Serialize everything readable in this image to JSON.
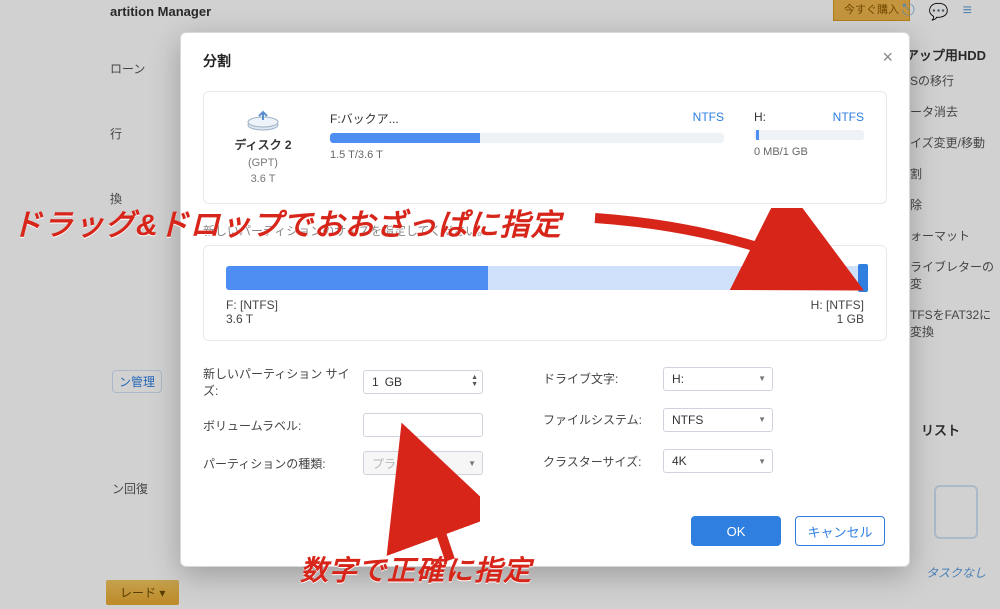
{
  "header": {
    "title_fragment": "artition Manager",
    "buy_button": "今すぐ購入"
  },
  "bg_left": [
    "ローン",
    "行",
    "換",
    "ン管理",
    "ン回復"
  ],
  "bg_upgrade": "レード ▾",
  "bg_right_title": "アップ用HDD",
  "bg_right_items": [
    "Sの移行",
    "ータ消去",
    "イズ変更/移動",
    "割",
    "除",
    "ォーマット",
    "ライブレターの変",
    "TFSをFAT32に変換"
  ],
  "bg_right_listlabel": "リスト",
  "bg_tasknone": "タスクなし",
  "modal": {
    "title": "分割",
    "disk": {
      "name": "ディスク 2",
      "style": "(GPT)",
      "size": "3.6 T"
    },
    "barA": {
      "label": "F:バックア...",
      "fs": "NTFS",
      "usage": "1.5 T/3.6 T"
    },
    "barB": {
      "label": "H:",
      "fs": "NTFS",
      "usage": "0 MB/1 GB"
    },
    "note": "新しいパーティションのサイズを指定してください。",
    "split": {
      "left_label": "F: [NTFS]",
      "left_sub": "3.6 T",
      "right_label": "H: [NTFS]",
      "right_sub": "1 GB"
    },
    "form": {
      "size_label": "新しいパーティション サイズ:",
      "size_value": "1",
      "size_unit": "GB",
      "volume_label": "ボリュームラベル:",
      "volume_value": "",
      "type_label": "パーティションの種類:",
      "type_value": "プライ...",
      "drive_label": "ドライブ文字:",
      "drive_value": "H:",
      "fs_label": "ファイルシステム:",
      "fs_value": "NTFS",
      "cluster_label": "クラスターサイズ:",
      "cluster_value": "4K"
    },
    "ok": "OK",
    "cancel": "キャンセル"
  },
  "annotation": {
    "text1": "ドラッグ&ドロップでおおざっぱに指定",
    "text2": "数字で正確に指定"
  }
}
